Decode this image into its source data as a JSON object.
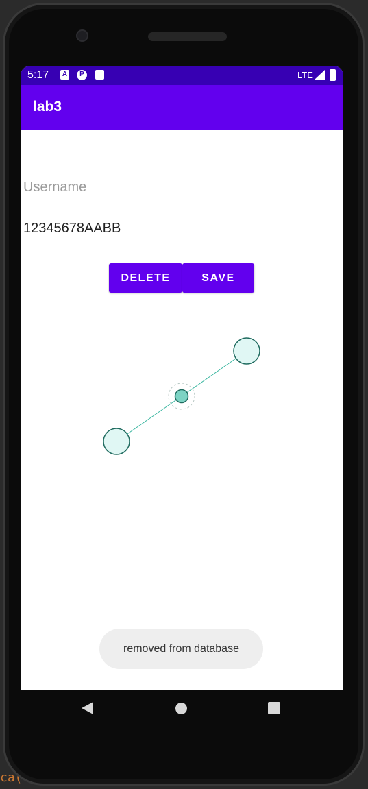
{
  "status_bar": {
    "time": "5:17",
    "icons": [
      "a-icon",
      "p-icon",
      "sd-card-icon"
    ],
    "network": "LTE"
  },
  "app_bar": {
    "title": "lab3"
  },
  "form": {
    "username": {
      "value": "",
      "placeholder": "Username"
    },
    "password": {
      "value": "12345678AABB",
      "placeholder": ""
    }
  },
  "buttons": {
    "delete_label": "DELETE",
    "save_label": "SAVE"
  },
  "toast": {
    "message": "removed from database"
  },
  "colors": {
    "status_bar": "#3700b3",
    "primary": "#6200ee",
    "handle_fill": "#e0f7f4",
    "handle_stroke": "#1f6b5f",
    "midpoint_fill": "#7dd3c4",
    "line": "#3cb7a1"
  },
  "ide": {
    "snippet": "ca("
  }
}
